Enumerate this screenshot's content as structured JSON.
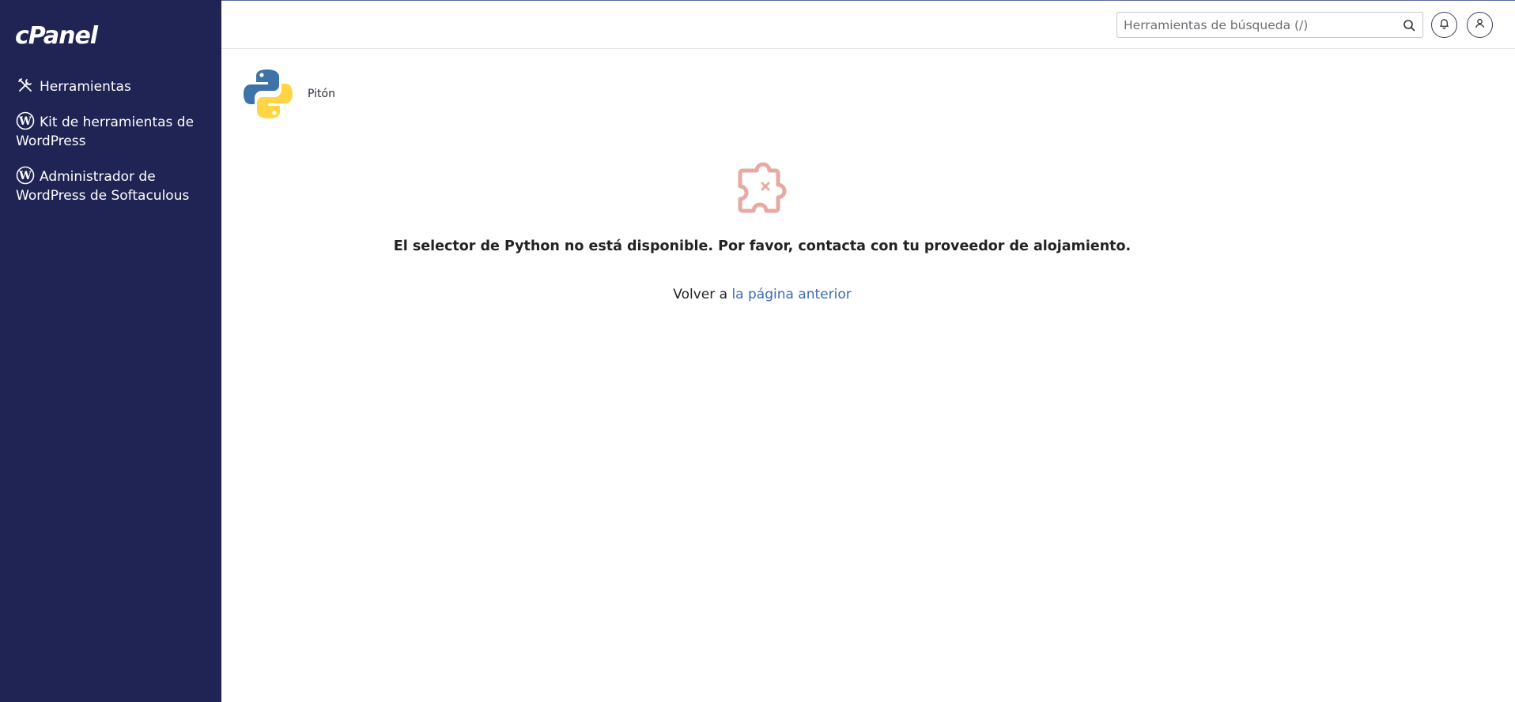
{
  "app": {
    "brand": "cPanel"
  },
  "sidebar": {
    "items": [
      {
        "label": "Herramientas",
        "icon": "tools-icon"
      },
      {
        "label": "Kit de herramientas de WordPress",
        "icon": "wordpress-icon"
      },
      {
        "label": "Administrador de WordPress de Softaculous",
        "icon": "wordpress-icon"
      }
    ],
    "background": "#1f2454"
  },
  "header": {
    "search_placeholder": "Herramientas de búsqueda (/)",
    "search_value": "",
    "icons": [
      "search-icon",
      "bell-icon",
      "user-icon"
    ]
  },
  "page": {
    "title": "Pitón",
    "icon": "python-logo",
    "error_icon": "puzzle-error-icon",
    "error_message": "El selector de Python no está disponible. Por favor, contacta con tu proveedor de alojamiento.",
    "back_prefix": "Volver a",
    "back_link": "la página anterior",
    "link_color": "#3d6ab8"
  }
}
